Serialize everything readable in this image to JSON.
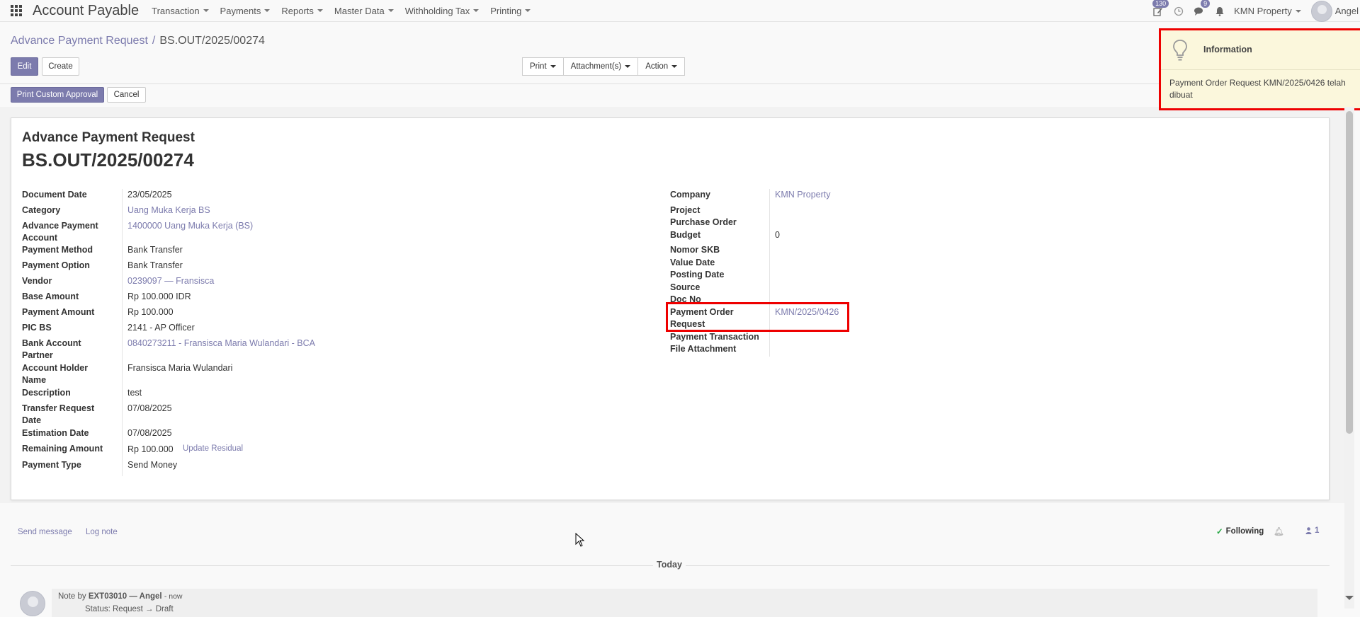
{
  "navbar": {
    "app_title": "Account Payable",
    "menus": [
      "Transaction",
      "Payments",
      "Reports",
      "Master Data",
      "Withholding Tax",
      "Printing"
    ],
    "activity_badge": "130",
    "messages_badge": "9",
    "company": "KMN Property",
    "user": "Angel"
  },
  "breadcrumb": {
    "parent": "Advance Payment Request",
    "separator": "/",
    "current": "BS.OUT/2025/00274"
  },
  "buttons": {
    "edit": "Edit",
    "create": "Create",
    "print": "Print",
    "attachments": "Attachment(s)",
    "action": "Action",
    "print_custom_approval": "Print Custom Approval",
    "cancel": "Cancel"
  },
  "form": {
    "subtitle": "Advance Payment Request",
    "title": "BS.OUT/2025/00274",
    "left": [
      {
        "label": "Document Date",
        "value": "23/05/2025"
      },
      {
        "label": "Category",
        "value": "Uang Muka Kerja BS"
      },
      {
        "label": "Advance Payment Account",
        "value": "1400000 Uang Muka Kerja (BS)"
      },
      {
        "label": "Payment Method",
        "value": "Bank Transfer"
      },
      {
        "label": "Payment Option",
        "value": "Bank Transfer"
      },
      {
        "label": "Vendor",
        "value": "0239097 — Fransisca"
      },
      {
        "label": "Base Amount",
        "value": "Rp 100.000 IDR"
      },
      {
        "label": "Payment Amount",
        "value": "Rp 100.000"
      },
      {
        "label": "PIC BS",
        "value": "2141 - AP Officer"
      },
      {
        "label": "Bank Account Partner",
        "value": "0840273211 - Fransisca Maria Wulandari - BCA"
      },
      {
        "label": "Account Holder Name",
        "value": "Fransisca Maria Wulandari"
      },
      {
        "label": "Description",
        "value": "test"
      },
      {
        "label": "Transfer Request Date",
        "value": "07/08/2025"
      },
      {
        "label": "Estimation Date",
        "value": "07/08/2025"
      },
      {
        "label": "Remaining Amount",
        "value": "Rp 100.000"
      },
      {
        "label": "Payment Type",
        "value": "Send Money"
      }
    ],
    "update_residual": "Update Residual",
    "right": [
      {
        "label": "Company",
        "value": "KMN Property"
      },
      {
        "label": "Project",
        "value": ""
      },
      {
        "label": "Purchase Order",
        "value": ""
      },
      {
        "label": "Budget",
        "value": "0"
      },
      {
        "label": "Nomor SKB",
        "value": ""
      },
      {
        "label": "Value Date",
        "value": ""
      },
      {
        "label": "Posting Date",
        "value": ""
      },
      {
        "label": "Source",
        "value": ""
      },
      {
        "label": "Doc No",
        "value": ""
      },
      {
        "label": "Payment Order Request",
        "value": "KMN/2025/0426"
      },
      {
        "label": "Payment Transaction",
        "value": ""
      },
      {
        "label": "File Attachment",
        "value": ""
      }
    ]
  },
  "chatter": {
    "send_message": "Send message",
    "log_note": "Log note",
    "following": "Following",
    "followers_count": "1",
    "today": "Today",
    "note_prefix": "Note by",
    "note_author": "EXT03010 — Angel",
    "note_time": "- now",
    "note_line2": "Status: Request → Draft"
  },
  "notification": {
    "title": "Information",
    "body": "Payment Order Request KMN/2025/0426 telah dibuat"
  },
  "colors": {
    "brand": "#7c7bad",
    "highlight": "#e00000",
    "notify_bg": "#fbf7dc"
  }
}
